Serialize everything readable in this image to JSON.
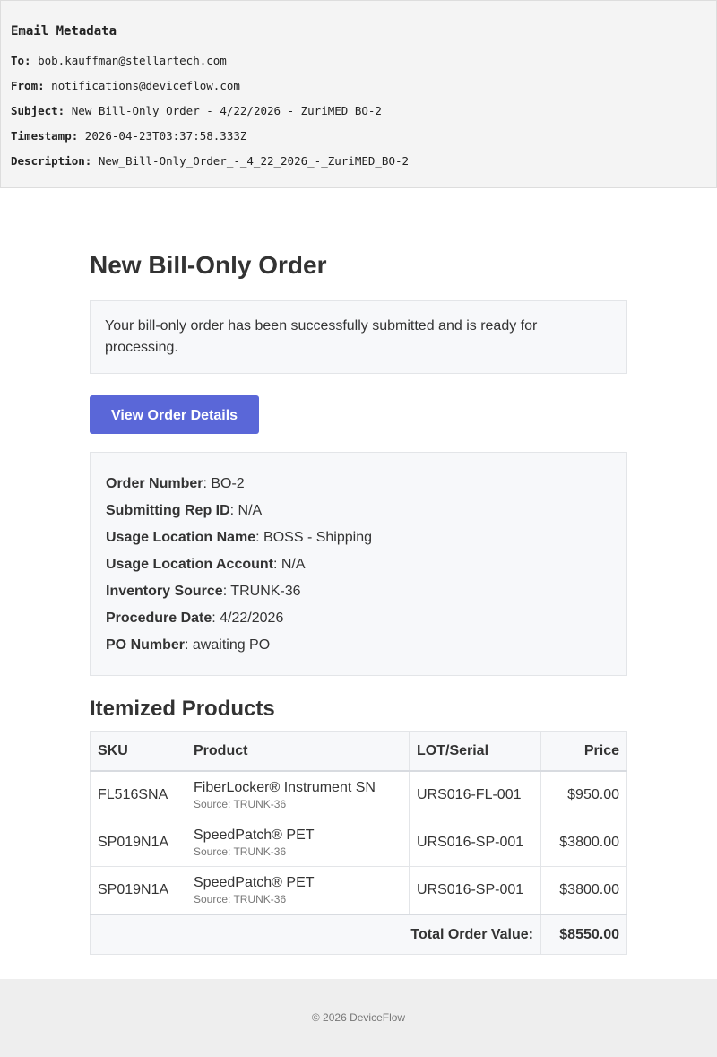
{
  "metadata": {
    "title": "Email Metadata",
    "to_label": "To:",
    "to": "bob.kauffman@stellartech.com",
    "from_label": "From:",
    "from": "notifications@deviceflow.com",
    "subject_label": "Subject:",
    "subject": "New Bill-Only Order - 4/22/2026 - ZuriMED BO-2",
    "timestamp_label": "Timestamp:",
    "timestamp": "2026-04-23T03:37:58.333Z",
    "description_label": "Description:",
    "description": "New_Bill-Only_Order_-_4_22_2026_-_ZuriMED_BO-2"
  },
  "main": {
    "title": "New Bill-Only Order",
    "notice": "Your bill-only order has been successfully submitted and is ready for processing.",
    "button_label": "View Order Details",
    "button_color": "#5a67d8"
  },
  "details": [
    {
      "label": "Order Number",
      "value": ": BO-2"
    },
    {
      "label": "Submitting Rep ID",
      "value": ": N/A"
    },
    {
      "label": "Usage Location Name",
      "value": ": BOSS - Shipping"
    },
    {
      "label": "Usage Location Account",
      "value": ": N/A"
    },
    {
      "label": "Inventory Source",
      "value": ": TRUNK-36"
    },
    {
      "label": "Procedure Date",
      "value": ": 4/22/2026"
    },
    {
      "label": "PO Number",
      "value": ": awaiting PO"
    }
  ],
  "products": {
    "title": "Itemized Products",
    "columns": [
      "SKU",
      "Product",
      "LOT/Serial",
      "Price"
    ],
    "rows": [
      {
        "sku": "FL516SNA",
        "product": "FiberLocker® Instrument SN",
        "source": "Source: TRUNK-36",
        "lot": "URS016-FL-001",
        "price": "$950.00"
      },
      {
        "sku": "SP019N1A",
        "product": "SpeedPatch® PET",
        "source": "Source: TRUNK-36",
        "lot": "URS016-SP-001",
        "price": "$3800.00"
      },
      {
        "sku": "SP019N1A",
        "product": "SpeedPatch® PET",
        "source": "Source: TRUNK-36",
        "lot": "URS016-SP-001",
        "price": "$3800.00"
      }
    ],
    "total_label": "Total Order Value:",
    "total_value": "$8550.00"
  },
  "footer": {
    "text": "© 2026 DeviceFlow"
  }
}
